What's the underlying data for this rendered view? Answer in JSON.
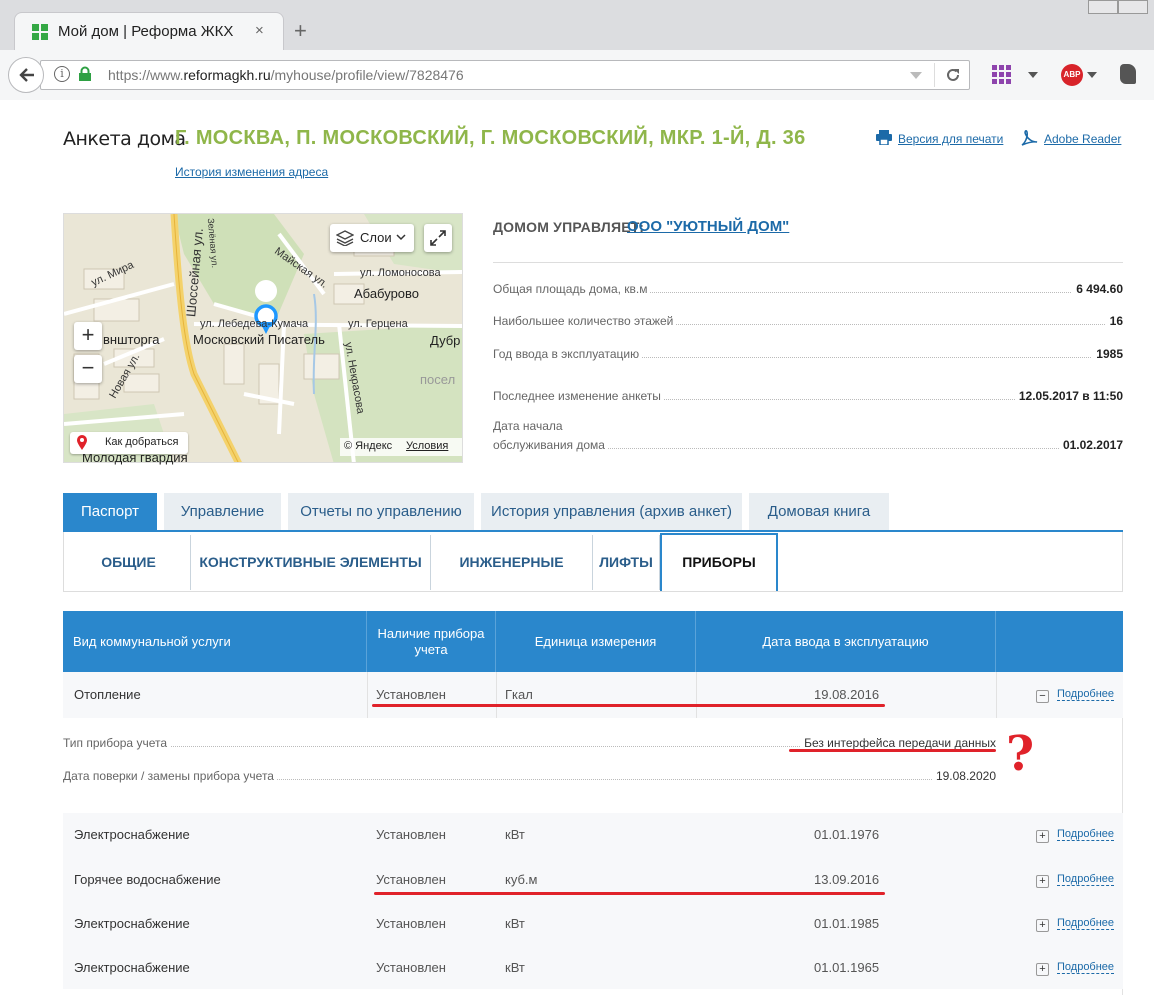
{
  "browser": {
    "tab_title": "Мой дом | Реформа ЖКХ",
    "tab_close": "×",
    "new_tab": "+",
    "url_prefix": "https://www.",
    "url_domain": "reformagkh.ru",
    "url_path": "/myhouse/profile/view/7828476",
    "adblock_label": "ABP"
  },
  "header": {
    "label": "Анкета дома",
    "address": "Г. МОСКВА, П. МОСКОВСКИЙ, Г. МОСКОВСКИЙ, МКР. 1-Й, Д. 36",
    "address_history": "История изменения адреса",
    "print_link": "Версия для печати",
    "adobe_link": "Adobe Reader"
  },
  "map": {
    "layers_button": "Слои",
    "zoom_in": "+",
    "zoom_out": "−",
    "route_button": "Как добраться",
    "copyright": "© Яндекс",
    "terms_link": "Условия",
    "labels": [
      "ул. Мира",
      "Шоссейная ул.",
      "Зелёная ул.",
      "Майская ул.",
      "ул. Ломоносова",
      "Абабурово",
      "ул. Лебедева-Кумача",
      "ул. Герцена",
      "Московский Писатель",
      "Дубр",
      "вншторга",
      "Новая ул.",
      "ул. Некрасова",
      "посел",
      "Молодая гвардия"
    ]
  },
  "management": {
    "label": "ДОМОМ УПРАВЛЯЕТ:",
    "value": "ООО \"УЮТНЫЙ ДОМ\""
  },
  "info": [
    {
      "label": "Общая площадь дома, кв.м",
      "value": "6 494.60"
    },
    {
      "label": "Наибольшее количество этажей",
      "value": "16"
    },
    {
      "label": "Год ввода в эксплуатацию",
      "value": "1985"
    },
    {
      "label": "Последнее изменение анкеты",
      "value": "12.05.2017 в 11:50"
    },
    {
      "label_line1": "Дата начала",
      "label_line2": "обслуживания дома",
      "value": "01.02.2017"
    }
  ],
  "tabs": [
    "Паспорт",
    "Управление",
    "Отчеты по управлению",
    "История управления (архив анкет)",
    "Домовая книга"
  ],
  "subtabs": [
    "ОБЩИЕ СВЕДЕНИЯ",
    "КОНСТРУКТИВНЫЕ ЭЛЕМЕНТЫ ДОМА",
    "ИНЖЕНЕРНЫЕ СИСТЕМЫ",
    "ЛИФТЫ",
    "ПРИБОРЫ УЧЕТА"
  ],
  "table": {
    "headers": [
      "Вид коммунальной услуги",
      "Наличие прибора учета",
      "Единица измерения",
      "Дата ввода в эксплуатацию"
    ],
    "more_label": "Подробнее",
    "expand_symbol": "+",
    "collapse_symbol": "−",
    "rows": [
      {
        "service": "Отопление",
        "status": "Установлен",
        "unit": "Гкал",
        "date": "19.08.2016"
      },
      {
        "service": "Электроснабжение",
        "status": "Установлен",
        "unit": "кВт",
        "date": "01.01.1976"
      },
      {
        "service": "Горячее водоснабжение",
        "status": "Установлен",
        "unit": "куб.м",
        "date": "13.09.2016"
      },
      {
        "service": "Электроснабжение",
        "status": "Установлен",
        "unit": "кВт",
        "date": "01.01.1985"
      },
      {
        "service": "Электроснабжение",
        "status": "Установлен",
        "unit": "кВт",
        "date": "01.01.1965"
      }
    ],
    "details": [
      {
        "label": "Тип прибора учета",
        "value": "Без интерфейса передачи данных"
      },
      {
        "label": "Дата поверки / замены прибора учета",
        "value": "19.08.2020"
      }
    ]
  },
  "annotation": {
    "question_mark": "?"
  },
  "colors": {
    "accent": "#2a87cc",
    "address": "#8fb64a",
    "link": "#1c6aa8",
    "annotation": "#e0222a"
  }
}
